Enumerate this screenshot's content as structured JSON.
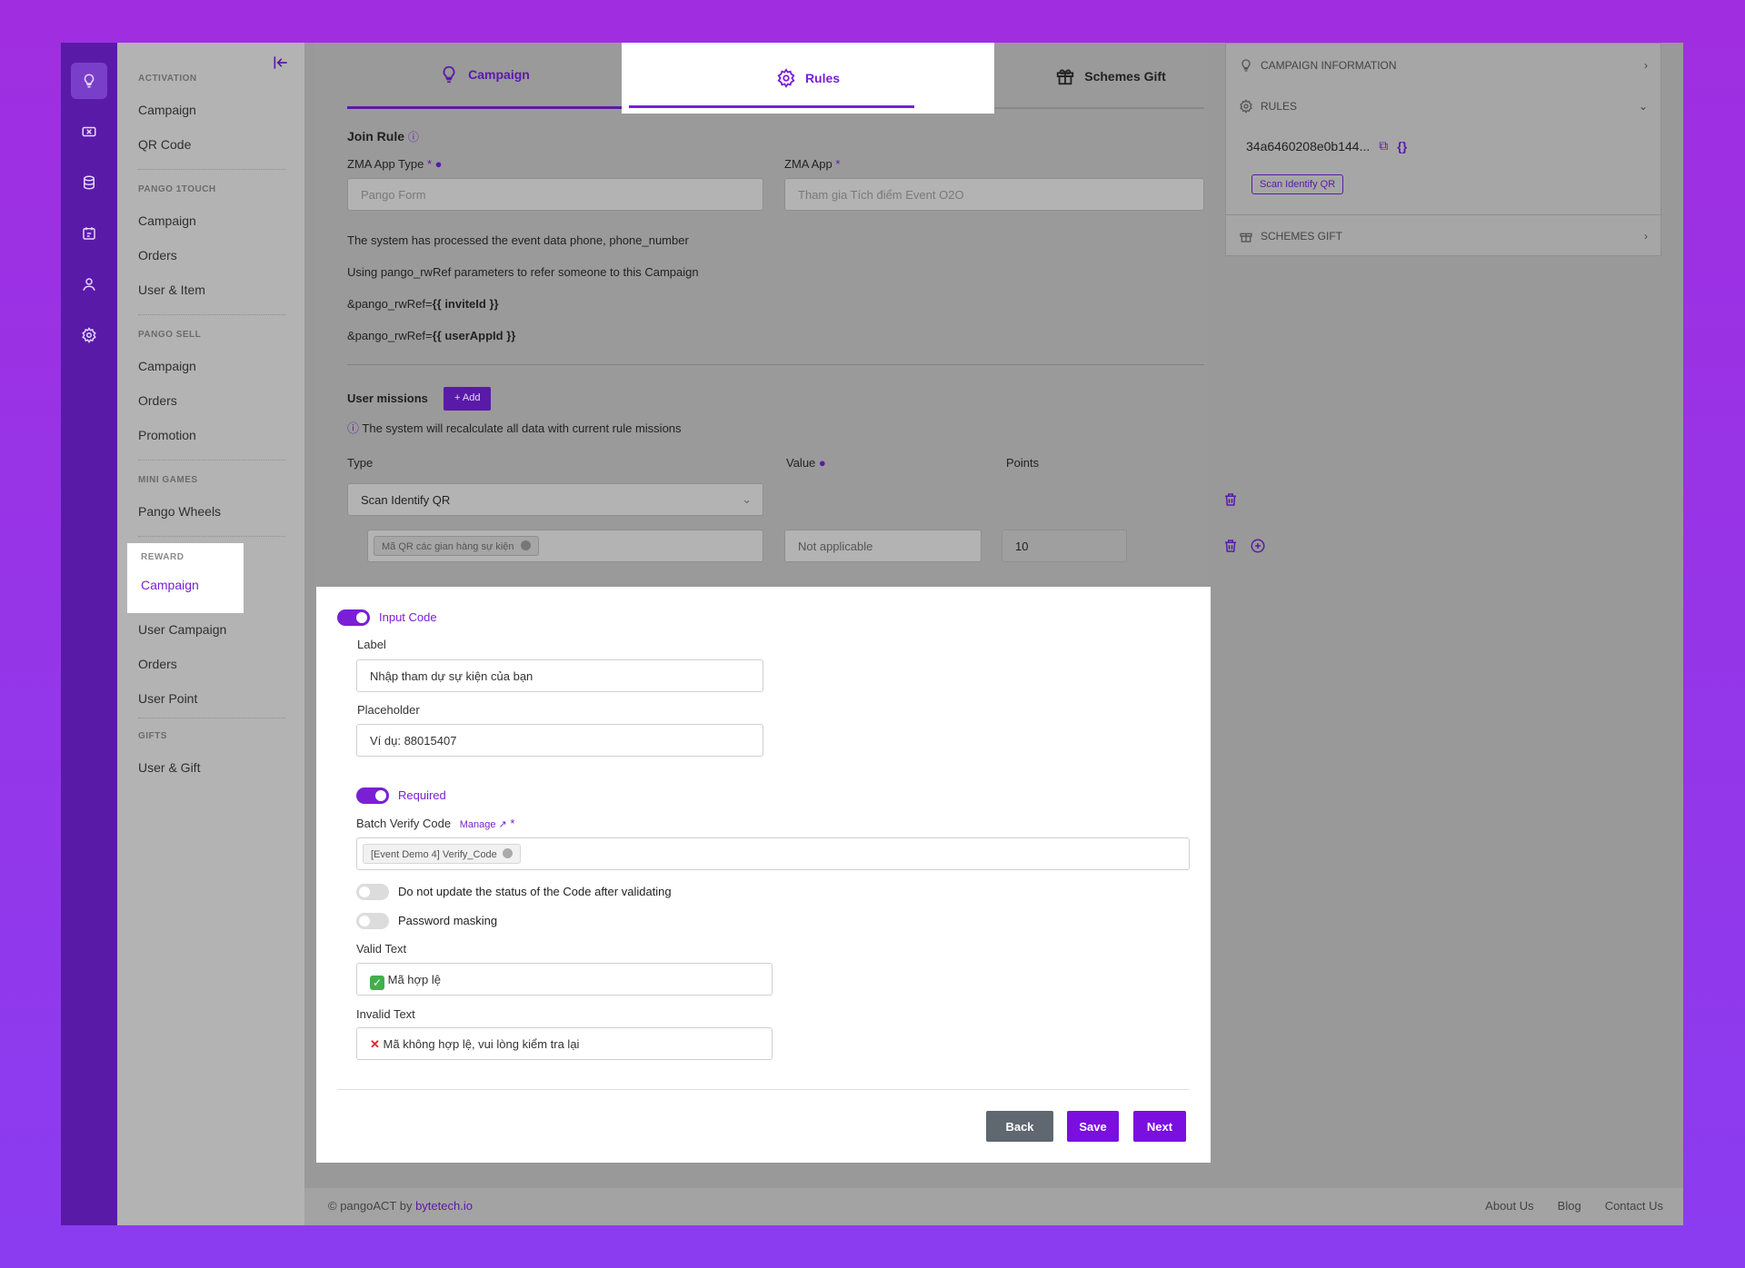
{
  "sidebar": {
    "sections": [
      {
        "title": "ACTIVATION",
        "items": [
          "Campaign",
          "QR Code"
        ]
      },
      {
        "title": "PANGO 1TOUCH",
        "items": [
          "Campaign",
          "Orders",
          "User & Item"
        ]
      },
      {
        "title": "PANGO SELL",
        "items": [
          "Campaign",
          "Orders",
          "Promotion"
        ]
      },
      {
        "title": "MINI GAMES",
        "items": [
          "Pango Wheels"
        ]
      },
      {
        "title": "REWARD",
        "items": [
          "Campaign",
          "User Campaign",
          "Orders",
          "User Point"
        ]
      },
      {
        "title": "GIFTS",
        "items": [
          "User & Gift"
        ]
      }
    ]
  },
  "tabs": {
    "campaign": "Campaign",
    "rules": "Rules",
    "schemes": "Schemes Gift"
  },
  "join_rule": {
    "title": "Join Rule",
    "app_type_label": "ZMA App Type",
    "app_type_value": "Pango Form",
    "app_label": "ZMA App",
    "app_value": "Tham gia Tích điểm Event O2O",
    "info1": "The system has processed the event data phone, phone_number",
    "info2": "Using pango_rwRef parameters to refer someone to this Campaign",
    "ref1_prefix": "&pango_rwRef=",
    "ref1_code": "{{ inviteId }}",
    "ref2_prefix": "&pango_rwRef=",
    "ref2_code": "{{ userAppId }}"
  },
  "missions": {
    "title": "User missions",
    "add_label": "+ Add",
    "note": "The system will recalculate all data with current rule missions",
    "col_type": "Type",
    "col_value": "Value",
    "col_points": "Points",
    "type_value": "Scan Identify QR",
    "chip": "Mã QR các gian hàng sự kiện",
    "value_placeholder": "Not applicable",
    "points": "10"
  },
  "form": {
    "input_code_label": "Input Code",
    "label_label": "Label",
    "label_value": "Nhập tham dự sự kiện của bạn",
    "placeholder_label": "Placeholder",
    "placeholder_value": "Ví dụ: 88015407",
    "required_label": "Required",
    "batch_label": "Batch Verify Code",
    "manage_label": "Manage",
    "batch_chip": "[Event Demo 4] Verify_Code",
    "no_update_label": "Do not update the status of the Code after validating",
    "password_label": "Password masking",
    "valid_label": "Valid Text",
    "valid_value": "Mã hợp lệ",
    "invalid_label": "Invalid Text",
    "invalid_value": "Mã không hợp lệ, vui lòng kiểm tra lại",
    "back": "Back",
    "save": "Save",
    "next": "Next"
  },
  "right_panel": {
    "campaign_info": "CAMPAIGN INFORMATION",
    "rules": "RULES",
    "rule_id": "34a6460208e0b144...",
    "scan_chip": "Scan Identify QR",
    "schemes": "SCHEMES GIFT"
  },
  "footer": {
    "copyright": "© pangoACT by",
    "brand": "bytetech.io",
    "links": [
      "About Us",
      "Blog",
      "Contact Us"
    ]
  },
  "colors": {
    "accent": "#7a1fd6",
    "rail": "#5a1aa8",
    "back_button": "#5f6770"
  }
}
